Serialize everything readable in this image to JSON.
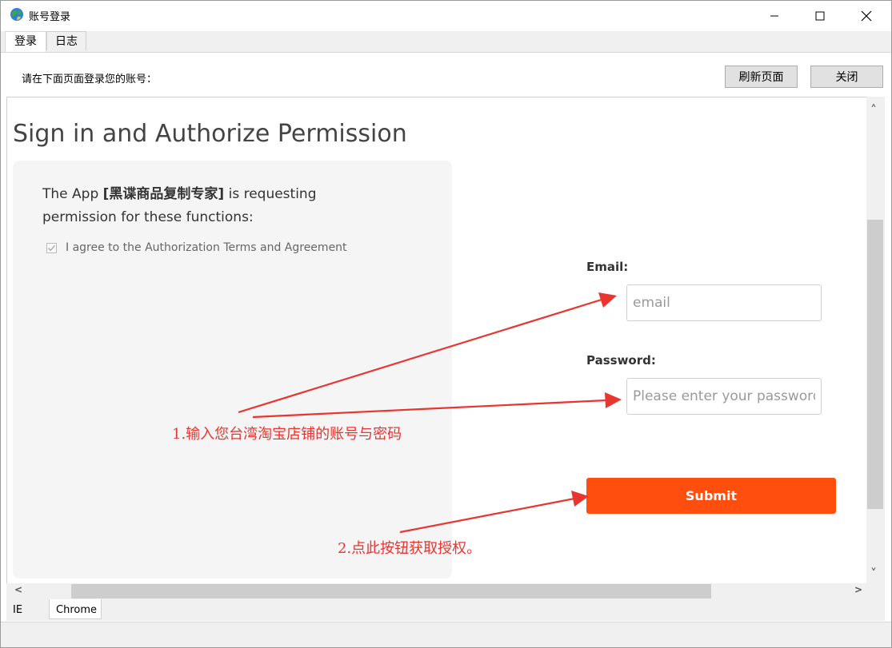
{
  "window": {
    "title": "账号登录",
    "minimize_glyph": "—",
    "maximize_glyph": "☐",
    "close_glyph": "✕"
  },
  "tabs": [
    {
      "label": "登录",
      "active": true
    },
    {
      "label": "日志",
      "active": false
    }
  ],
  "toolbar": {
    "message": "请在下面页面登录您的账号：",
    "refresh_label": "刷新页面",
    "close_label": "关闭"
  },
  "page": {
    "heading": "Sign in and Authorize Permission",
    "request_prefix": "The App",
    "app_name": "[黑谍商品复制专家]",
    "request_suffix": "is requesting permission for these functions:",
    "agree_label": "I agree to the Authorization Terms and Agreement",
    "agree_checked": true,
    "email_label": "Email:",
    "email_placeholder": "email",
    "password_label": "Password:",
    "password_placeholder": "Please enter your password",
    "submit_label": "Submit",
    "submit_color": "#ff4e0d"
  },
  "annotations": {
    "note1": "1.输入您台湾淘宝店铺的账号与密码",
    "note2": "2.点此按钮获取授权。",
    "arrow_color": "#e8352f"
  },
  "browser_tabs": [
    {
      "label": "IE",
      "active": false
    },
    {
      "label": "Chrome",
      "active": true
    }
  ],
  "scroll_arrows": {
    "up": "˄",
    "down": "˅",
    "left": "<",
    "right": ">"
  }
}
